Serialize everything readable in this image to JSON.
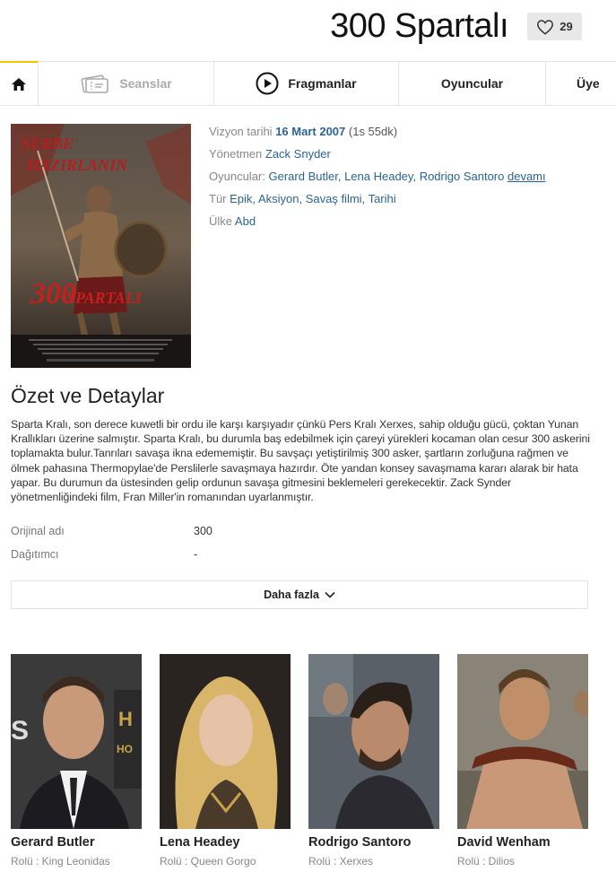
{
  "header": {
    "title": "300 Spartalı",
    "like_count": "29"
  },
  "nav": {
    "home_icon": "home-icon",
    "items": [
      {
        "label": "Seanslar",
        "icon": "tickets-icon"
      },
      {
        "label": "Fragmanlar",
        "icon": "play-icon"
      },
      {
        "label": "Oyuncular"
      },
      {
        "label": "Üye"
      }
    ]
  },
  "poster": {
    "top_text": "SERBE HAZIRLANIN",
    "logo_text_1": "300",
    "logo_text_2": "SPARTALI"
  },
  "info": {
    "release_label": "Vizyon tarihi",
    "release_date": "16 Mart 2007",
    "duration": "(1s 55dk)",
    "director_label": "Yönetmen",
    "director": "Zack Snyder",
    "actors_label": "Oyuncular:",
    "actors": [
      "Gerard Butler,",
      "Lena Headey,",
      "Rodrigo Santoro"
    ],
    "actors_more": "devamı",
    "genre_label": "Tür",
    "genres": [
      "Epik,",
      "Aksiyon,",
      "Savaş filmi,",
      "Tarihi"
    ],
    "country_label": "Ülke",
    "country": "Abd"
  },
  "summary": {
    "title": "Özet ve Detaylar",
    "text": "Sparta Kralı, son derece kuwetli bir ordu ile karşı karşıyadır çünkü Pers Kralı Xerxes, sahip olduğu gücü, çoktan Yunan Krallıkları üzerine salmıştır. Sparta Kralı, bu durumla baş edebilmek için çareyi yürekleri kocaman olan cesur 300 askerini toplamakta bulur.Tanrıları savaşa ikna edememiştir. Bu savşaçı yetiştirilmiş 300 asker, şartların zorluğuna rağmen ve ölmek pahasına Thermopylae'de Perslilerle savaşmaya hazırdır. Öte yandan konsey savaşmama kararı alarak bir hata yapar. Bu durumun da üstesinden gelip ordunun savaşa gitmesini beklemeleri gerekecektir. Zack Synder yönetmenliğindeki film, Fran Miller'in romanından uyarlanmıştır.",
    "details": [
      {
        "key": "Orijinal adı",
        "value": "300"
      },
      {
        "key": "Dağıtımcı",
        "value": "-"
      }
    ],
    "more_button": "Daha fazla"
  },
  "cast": [
    {
      "name": "Gerard Butler",
      "role": "Rolü : King Leonidas"
    },
    {
      "name": "Lena Headey",
      "role": "Rolü : Queen Gorgo"
    },
    {
      "name": "Rodrigo Santoro",
      "role": "Rolü : Xerxes"
    },
    {
      "name": "David Wenham",
      "role": "Rolü : Dilios"
    }
  ],
  "colors": {
    "accent": "#f2c500",
    "link": "#2a6496"
  }
}
